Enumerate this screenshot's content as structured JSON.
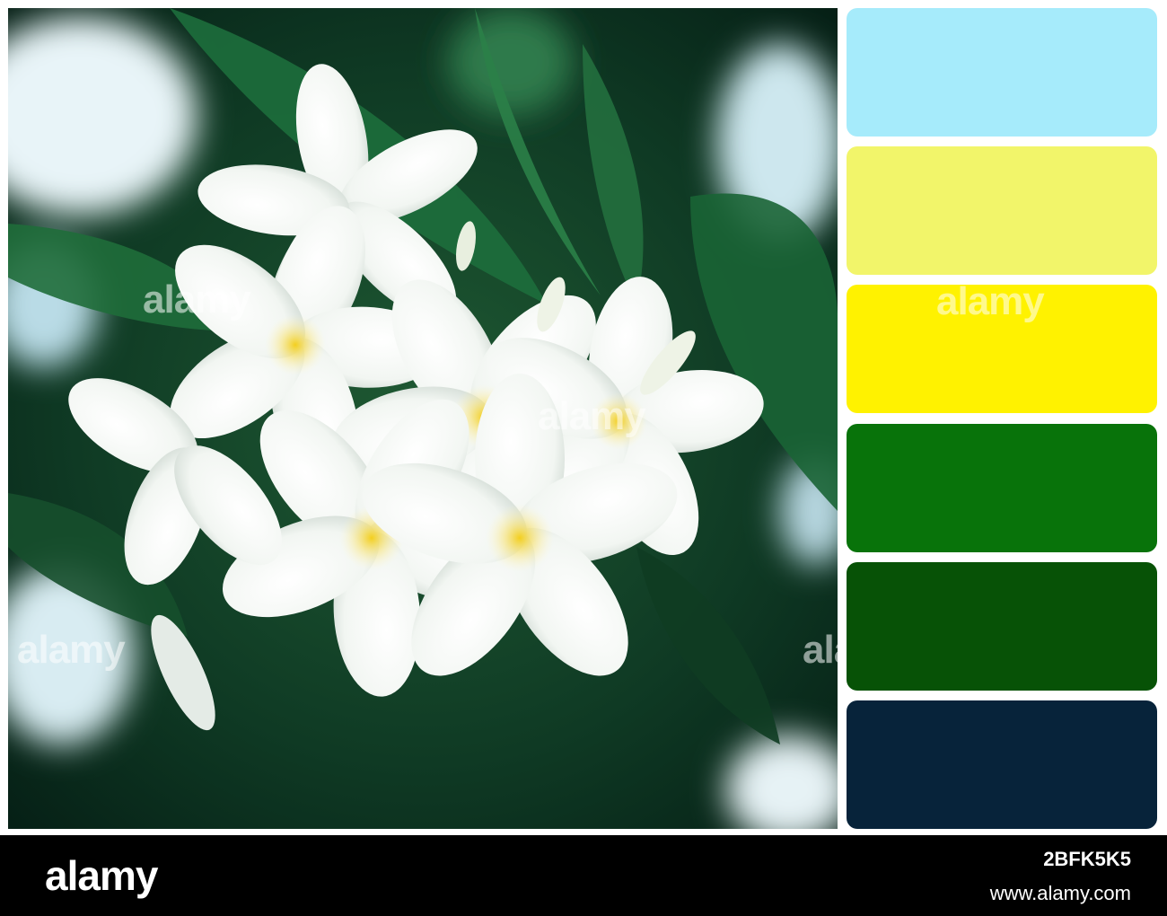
{
  "photo": {
    "subject": "white and yellow plumeria flowers against green leaves"
  },
  "palette": {
    "swatches": [
      {
        "color": "#a6ebfb"
      },
      {
        "color": "#f2f56a"
      },
      {
        "color": "#fff200"
      },
      {
        "color": "#08730a"
      },
      {
        "color": "#075206"
      },
      {
        "color": "#07233a"
      }
    ]
  },
  "watermark": {
    "text": "alamy"
  },
  "footer": {
    "logo": "alamy",
    "image_id": "2BFK5K5",
    "url": "www.alamy.com"
  }
}
